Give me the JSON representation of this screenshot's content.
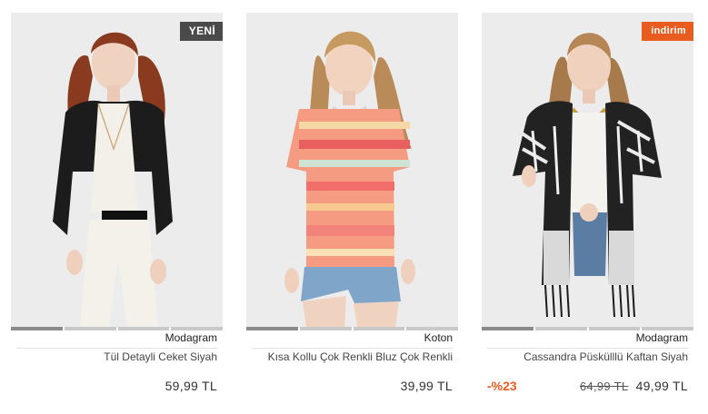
{
  "products": [
    {
      "brand": "Modagram",
      "name": "Tül Detayli Ceket Siyah",
      "price": "59,99 TL",
      "badge": "YENİ"
    },
    {
      "brand": "Koton",
      "name": "Kısa Kollu Çok Renkli Bluz Çok Renkli",
      "price": "39,99 TL"
    },
    {
      "brand": "Modagram",
      "name": "Cassandra Püskülllü Kaftan Siyah",
      "old_price": "64,99 TL",
      "price": "49,99 TL",
      "discount": "-%23",
      "badge": "indirim"
    }
  ],
  "colors": {
    "sale_accent": "#e85c1f",
    "new_badge": "#4a4a4a"
  }
}
